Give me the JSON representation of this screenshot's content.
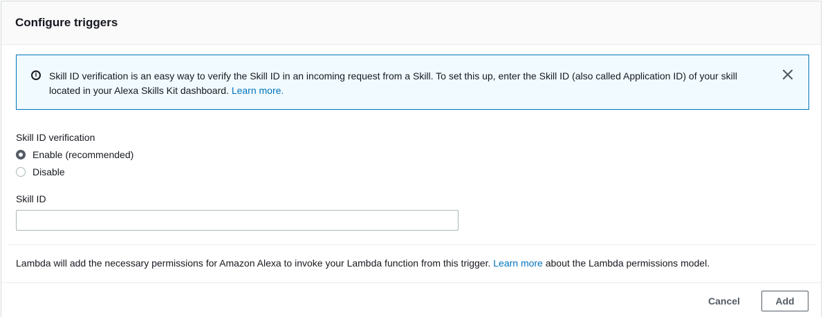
{
  "header": {
    "title": "Configure triggers"
  },
  "info_alert": {
    "icon": "info-icon",
    "text": "Skill ID verification is an easy way to verify the Skill ID in an incoming request from a Skill. To set this up, enter the Skill ID (also called Application ID) of your skill located in your Alexa Skills Kit dashboard.",
    "link_label": "Learn more.",
    "close_icon": "close-icon"
  },
  "verification": {
    "label": "Skill ID verification",
    "options": [
      {
        "label": "Enable (recommended)",
        "selected": true
      },
      {
        "label": "Disable",
        "selected": false
      }
    ]
  },
  "skill_id": {
    "label": "Skill ID",
    "value": "",
    "placeholder": ""
  },
  "permissions_note": {
    "text_before": "Lambda will add the necessary permissions for Amazon Alexa to invoke your Lambda function from this trigger.",
    "link_label": "Learn more",
    "text_after": "about the Lambda permissions model."
  },
  "footer": {
    "cancel_label": "Cancel",
    "add_label": "Add"
  },
  "colors": {
    "accent": "#0073bb",
    "info_background": "#f1faff",
    "text": "#16191f",
    "button_text": "#545b64"
  }
}
